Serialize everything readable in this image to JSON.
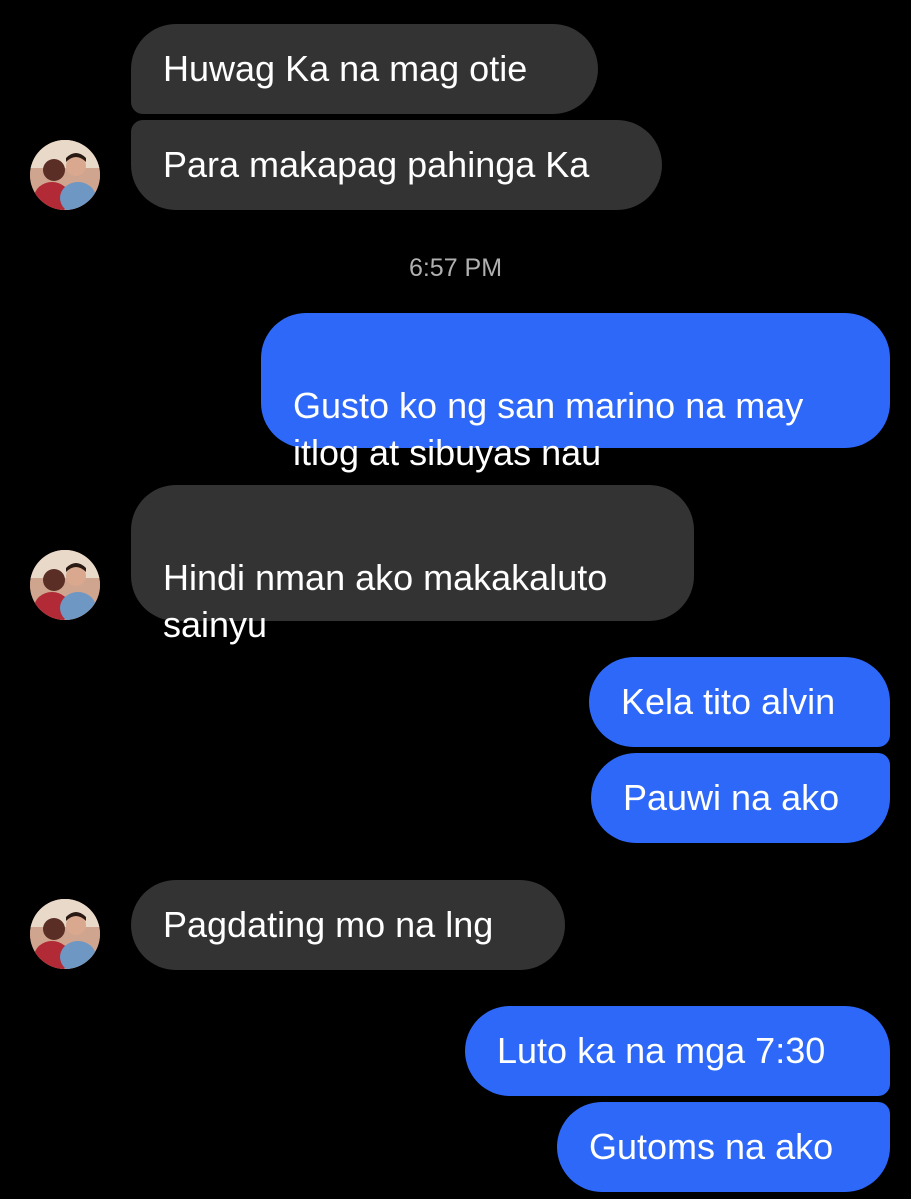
{
  "incoming": [
    {
      "text": "Huwag Ka na mag otie"
    },
    {
      "text": "Para makapag pahinga Ka"
    },
    {
      "text": "Hindi nman ako makakaluto\nsainyu"
    },
    {
      "text": "Pagdating mo na lng"
    }
  ],
  "timestamp": "6:57 PM",
  "outgoing": [
    {
      "text": "Gusto ko ng san marino na may\nitlog at sibuyas nau"
    },
    {
      "text": "Kela tito alvin"
    },
    {
      "text": "Pauwi na ako"
    },
    {
      "text": "Luto ka na mga 7:30"
    },
    {
      "text": "Gutoms na ako"
    }
  ],
  "colors": {
    "background": "#000000",
    "incoming_bubble": "#333333",
    "outgoing_bubble": "#2d68f8",
    "text": "#ffffff",
    "timestamp": "#b0b0b0"
  },
  "avatar_icon": "contact-profile-photo"
}
